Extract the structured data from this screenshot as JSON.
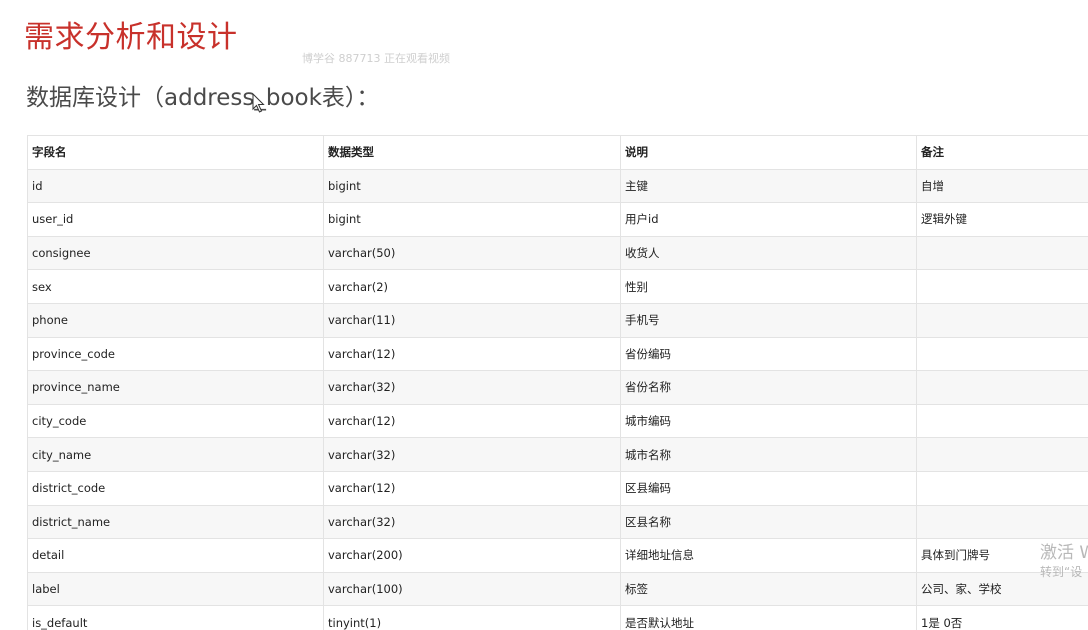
{
  "title": "需求分析和设计",
  "watermark": "博学谷 887713 正在观看视频",
  "subtitle": "数据库设计（address_book表）：",
  "table": {
    "headers": [
      "字段名",
      "数据类型",
      "说明",
      "备注"
    ],
    "rows": [
      [
        "id",
        "bigint",
        "主键",
        "自增"
      ],
      [
        "user_id",
        "bigint",
        "用户id",
        "逻辑外键"
      ],
      [
        "consignee",
        "varchar(50)",
        "收货人",
        ""
      ],
      [
        "sex",
        "varchar(2)",
        "性别",
        ""
      ],
      [
        "phone",
        "varchar(11)",
        "手机号",
        ""
      ],
      [
        "province_code",
        "varchar(12)",
        "省份编码",
        ""
      ],
      [
        "province_name",
        "varchar(32)",
        "省份名称",
        ""
      ],
      [
        "city_code",
        "varchar(12)",
        "城市编码",
        ""
      ],
      [
        "city_name",
        "varchar(32)",
        "城市名称",
        ""
      ],
      [
        "district_code",
        "varchar(12)",
        "区县编码",
        ""
      ],
      [
        "district_name",
        "varchar(32)",
        "区县名称",
        ""
      ],
      [
        "detail",
        "varchar(200)",
        "详细地址信息",
        "具体到门牌号"
      ],
      [
        "label",
        "varchar(100)",
        "标签",
        "公司、家、学校"
      ],
      [
        "is_default",
        "tinyint(1)",
        "是否默认地址",
        "1是 0否"
      ]
    ]
  },
  "activation": {
    "line1": "激活 W",
    "line2": "转到“设"
  },
  "colors": {
    "title": "#c8312b",
    "subtitle": "#4a4a4a",
    "border": "#e3e3e3",
    "stripe": "#f7f7f7"
  },
  "icons": {
    "cursor": "mouse-pointer-icon"
  }
}
